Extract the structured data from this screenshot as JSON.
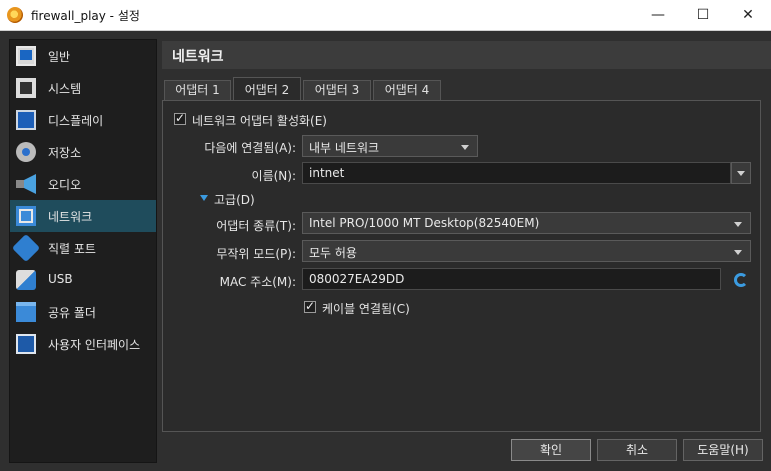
{
  "window": {
    "title": "firewall_play - 설정",
    "minimize": "—",
    "maximize": "☐",
    "close": "✕"
  },
  "sidebar": {
    "items": [
      {
        "label": "일반",
        "icon": "general-monitor-icon"
      },
      {
        "label": "시스템",
        "icon": "system-chip-icon"
      },
      {
        "label": "디스플레이",
        "icon": "display-icon"
      },
      {
        "label": "저장소",
        "icon": "storage-disk-icon"
      },
      {
        "label": "오디오",
        "icon": "audio-speaker-icon"
      },
      {
        "label": "네트워크",
        "icon": "network-icon",
        "active": true
      },
      {
        "label": "직렬 포트",
        "icon": "serial-port-icon"
      },
      {
        "label": "USB",
        "icon": "usb-icon"
      },
      {
        "label": "공유 폴더",
        "icon": "shared-folder-icon"
      },
      {
        "label": "사용자 인터페이스",
        "icon": "user-interface-icon"
      }
    ]
  },
  "main": {
    "section_title": "네트워크",
    "tabs": [
      {
        "label": "어댑터 1",
        "active": false
      },
      {
        "label": "어댑터 2",
        "active": true
      },
      {
        "label": "어댑터 3",
        "active": false
      },
      {
        "label": "어댑터 4",
        "active": false
      }
    ],
    "enable_adapter": {
      "label": "네트워크 어댑터 활성화(E)",
      "checked": true
    },
    "attached_to": {
      "label": "다음에 연결됨(A):",
      "value": "내부 네트워크"
    },
    "name": {
      "label": "이름(N):",
      "value": "intnet"
    },
    "advanced": {
      "label": "고급(D)",
      "expanded": true
    },
    "adapter_type": {
      "label": "어댑터 종류(T):",
      "value": "Intel PRO/1000 MT Desktop(82540EM)"
    },
    "promiscuous_mode": {
      "label": "무작위 모드(P):",
      "value": "모두 허용"
    },
    "mac_address": {
      "label": "MAC 주소(M):",
      "value": "080027EA29DD"
    },
    "cable_connected": {
      "label": "케이블 연결됨(C)",
      "checked": true
    }
  },
  "buttons": {
    "ok": "확인",
    "cancel": "취소",
    "help": "도움말(H)"
  },
  "colors": {
    "background": "#2f2f2f",
    "sidebar_active": "#1f4c5c",
    "accent": "#3b9be0"
  }
}
